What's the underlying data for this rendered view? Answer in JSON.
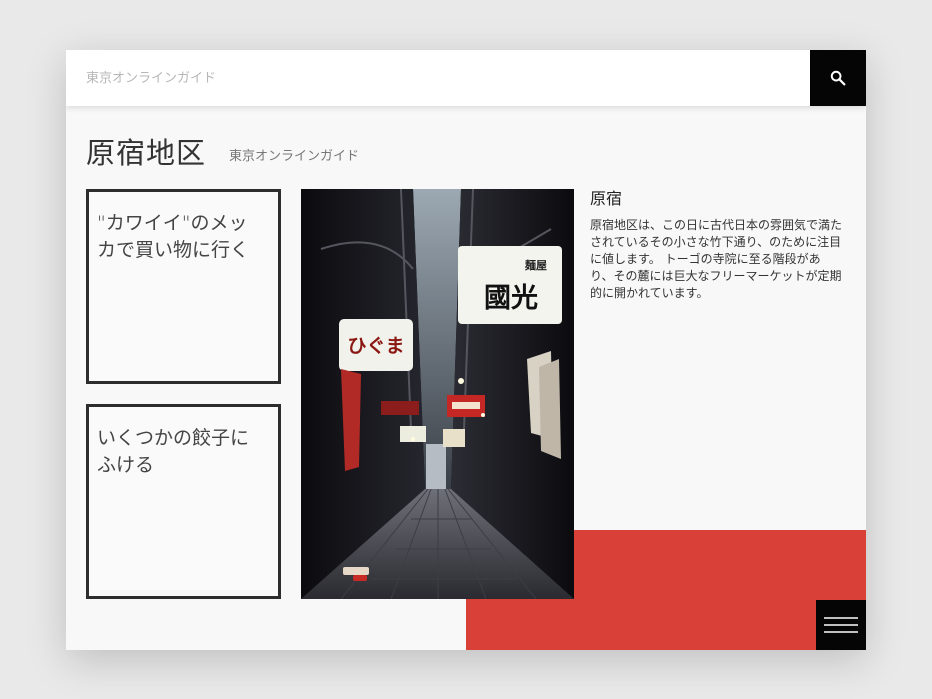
{
  "search": {
    "placeholder": "東京オンラインガイド",
    "value": "",
    "icon": "search-icon"
  },
  "header": {
    "title": "原宿地区",
    "subtitle": "東京オンラインガイド"
  },
  "cards": [
    {
      "text": "\"カワイイ\"のメッカで買い物に行く"
    },
    {
      "text": "いくつかの餃子にふける"
    }
  ],
  "article": {
    "title": "原宿",
    "body": "原宿地区は、この日に古代日本の雰囲気で満たされているその小さな竹下通り、のために注目に値します。 トーゴの寺院に至る階段があり、その麓には巨大なフリーマーケットが定期的に開かれています。"
  },
  "photo": {
    "signs": {
      "sign_1": "ひぐま",
      "sign_2_top": "麺屋",
      "sign_2_main": "國光"
    }
  },
  "menu": {
    "icon": "hamburger-menu-icon"
  },
  "colors": {
    "accent_red": "#d84038",
    "dark": "#050505",
    "background": "#f8f8f8"
  }
}
